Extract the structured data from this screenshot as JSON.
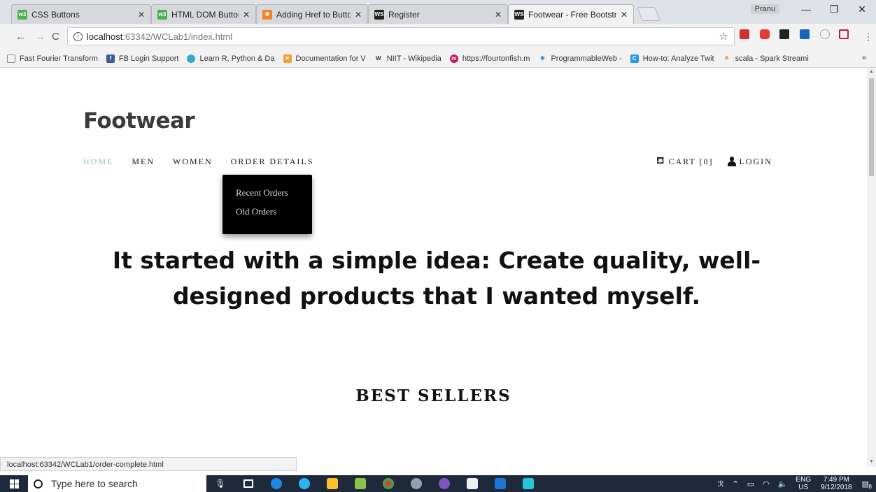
{
  "browser": {
    "tabs": [
      {
        "label": "CSS Buttons",
        "icon": "w3schools-icon",
        "color": "#4caf50"
      },
      {
        "label": "HTML DOM Button Obje",
        "icon": "w3schools-icon",
        "color": "#4caf50"
      },
      {
        "label": "Adding Href to Button - (",
        "icon": "stackoverflow-icon",
        "color": "#f48024"
      },
      {
        "label": "Register",
        "icon": "webstorm-icon",
        "color": "#222"
      },
      {
        "label": "Footwear - Free Bootstra",
        "icon": "webstorm-icon",
        "color": "#222",
        "active": true
      }
    ],
    "user": "Pranu",
    "url_host": "localhost",
    "url_rest": ":63342/WCLab1/index.html",
    "bookmarks": [
      {
        "label": "Fast Fourier Transform",
        "icon": "page-icon",
        "color": "#999"
      },
      {
        "label": "FB Login Support",
        "icon": "facebook-icon",
        "color": "#3b5998"
      },
      {
        "label": "Learn R, Python & Da",
        "icon": "datacamp-icon",
        "color": "#33aacc"
      },
      {
        "label": "Documentation for V",
        "icon": "vscode-icon",
        "color": "#f0a030"
      },
      {
        "label": "NIIT - Wikipedia",
        "icon": "wikipedia-icon",
        "color": "#333"
      },
      {
        "label": "https://fourtonfish.m",
        "icon": "fourtonfish-icon",
        "color": "#c2185b"
      },
      {
        "label": "ProgrammableWeb -",
        "icon": "programmableweb-icon",
        "color": "#3a8fd8"
      },
      {
        "label": "How-to: Analyze Twit",
        "icon": "cloudera-icon",
        "color": "#2196f3"
      },
      {
        "label": "scala - Spark Streami",
        "icon": "java-icon",
        "color": "#e88a1a"
      }
    ],
    "bookmarks_more": "»",
    "status_url": "localhost:63342/WCLab1/order-complete.html"
  },
  "site": {
    "logo": "Footwear",
    "nav": [
      "HOME",
      "MEN",
      "WOMEN",
      "ORDER DETAILS"
    ],
    "cart_label": "CART [0]",
    "login_label": "LOGIN",
    "dropdown": [
      "Recent Orders",
      "Old Orders"
    ],
    "hero": "It started with a simple idea: Create quality, well-designed products that I wanted myself.",
    "section_title": "BEST SELLERS",
    "accent_color": "#88c8bc"
  },
  "taskbar": {
    "search_placeholder": "Type here to search",
    "lang": "ENG",
    "region": "US",
    "time": "7:49 PM",
    "date": "9/12/2018",
    "notifications": "8"
  }
}
